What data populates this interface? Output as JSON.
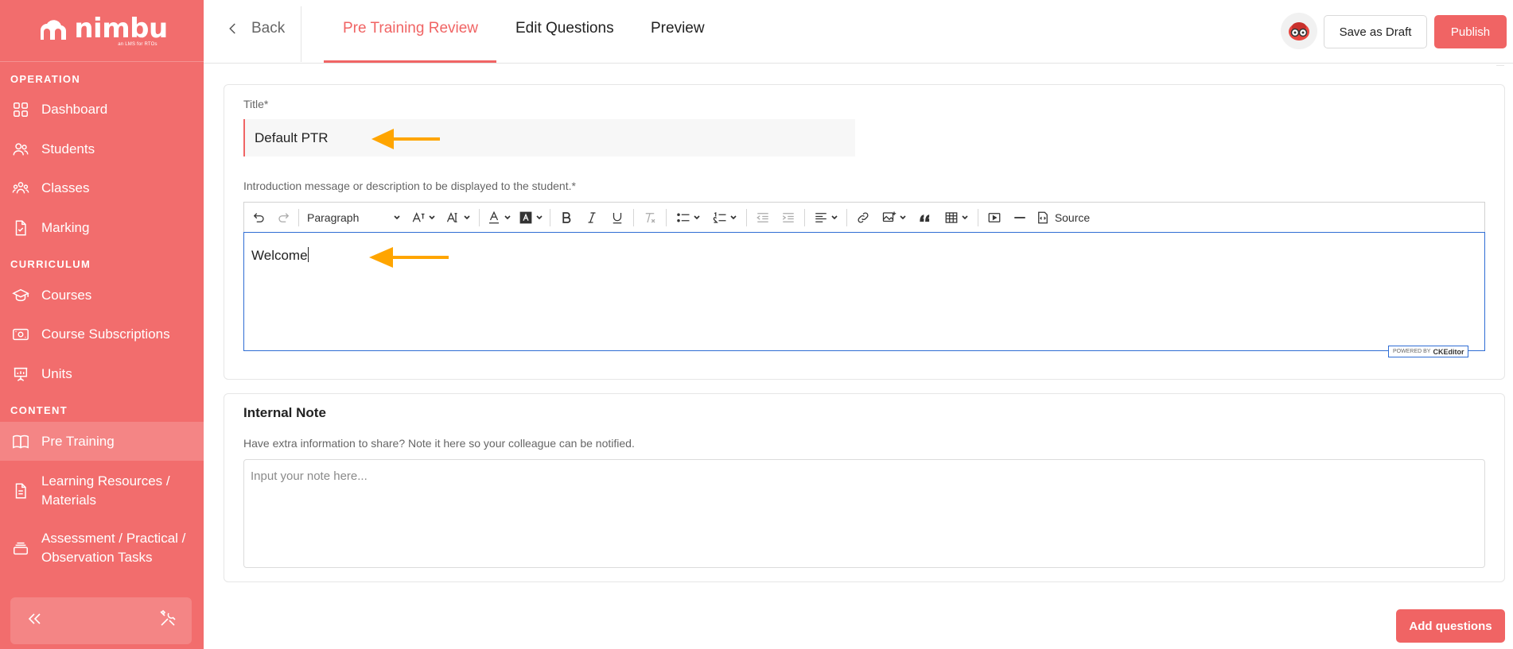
{
  "app": {
    "logo_text": "nimbu",
    "logo_tagline": "an LMS for RTOs"
  },
  "sidebar": {
    "sections": [
      {
        "label": "OPERATION"
      },
      {
        "label": "CURRICULUM"
      },
      {
        "label": "CONTENT"
      }
    ],
    "items": [
      {
        "label": "Dashboard",
        "icon": "grid-icon"
      },
      {
        "label": "Students",
        "icon": "users-icon"
      },
      {
        "label": "Classes",
        "icon": "group-icon"
      },
      {
        "label": "Marking",
        "icon": "document-check-icon"
      },
      {
        "label": "Courses",
        "icon": "graduation-cap-icon"
      },
      {
        "label": "Course Subscriptions",
        "icon": "subscription-icon"
      },
      {
        "label": "Units",
        "icon": "presentation-icon"
      },
      {
        "label": "Pre Training",
        "icon": "book-icon",
        "active": true
      },
      {
        "label": "Learning Resources / Materials",
        "icon": "file-icon"
      },
      {
        "label": "Assessment / Practical / Observation Tasks",
        "icon": "stack-icon"
      }
    ],
    "footer": {
      "collapse_icon": "double-chevron-left-icon",
      "tools_icon": "tools-icon"
    }
  },
  "topbar": {
    "back_label": "Back",
    "tabs": [
      {
        "label": "Pre Training Review",
        "active": true
      },
      {
        "label": "Edit Questions"
      },
      {
        "label": "Preview"
      }
    ],
    "save_draft_label": "Save as Draft",
    "publish_label": "Publish"
  },
  "form": {
    "title_label": "Title*",
    "title_value": "Default PTR",
    "intro_label": "Introduction message or description to be displayed to the student.*",
    "intro_value": "Welcome",
    "toolbar": {
      "paragraph_label": "Paragraph",
      "source_label": "Source"
    },
    "powered_by": "POWERED BY",
    "ckeditor": "CKEditor"
  },
  "note": {
    "title": "Internal Note",
    "help": "Have extra information to share? Note it here so your colleague can be notified.",
    "placeholder": "Input your note here..."
  },
  "actions": {
    "add_questions_label": "Add questions"
  },
  "colors": {
    "brand": "#f26d6d",
    "accent": "#f06464",
    "annotation_arrow": "#ffa500",
    "editor_focus": "#2f6dd4"
  }
}
